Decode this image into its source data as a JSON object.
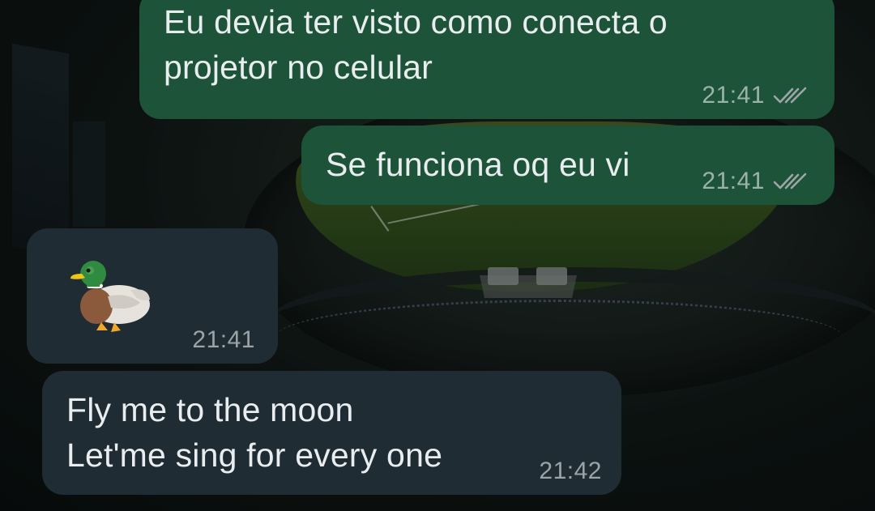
{
  "messages": [
    {
      "direction": "outgoing",
      "text": "Eu devia ter visto como conecta o\nprojetor no celular",
      "time": "21:41",
      "status_icon": "double-check-icon"
    },
    {
      "direction": "outgoing",
      "text": "Se funciona oq eu vi",
      "time": "21:41",
      "status_icon": "double-check-icon"
    },
    {
      "direction": "incoming",
      "sticker": "duck-emoji",
      "time": "21:41"
    },
    {
      "direction": "incoming",
      "text": "Fly me to the moon\nLet'me sing for every one",
      "time": "21:42"
    }
  ],
  "colors": {
    "outgoing_bubble": "#1d5338",
    "incoming_bubble": "#1f2c33",
    "text": "#e9edef",
    "meta_text": "#9ea5a8"
  },
  "wallpaper": "stadium-night-photo"
}
